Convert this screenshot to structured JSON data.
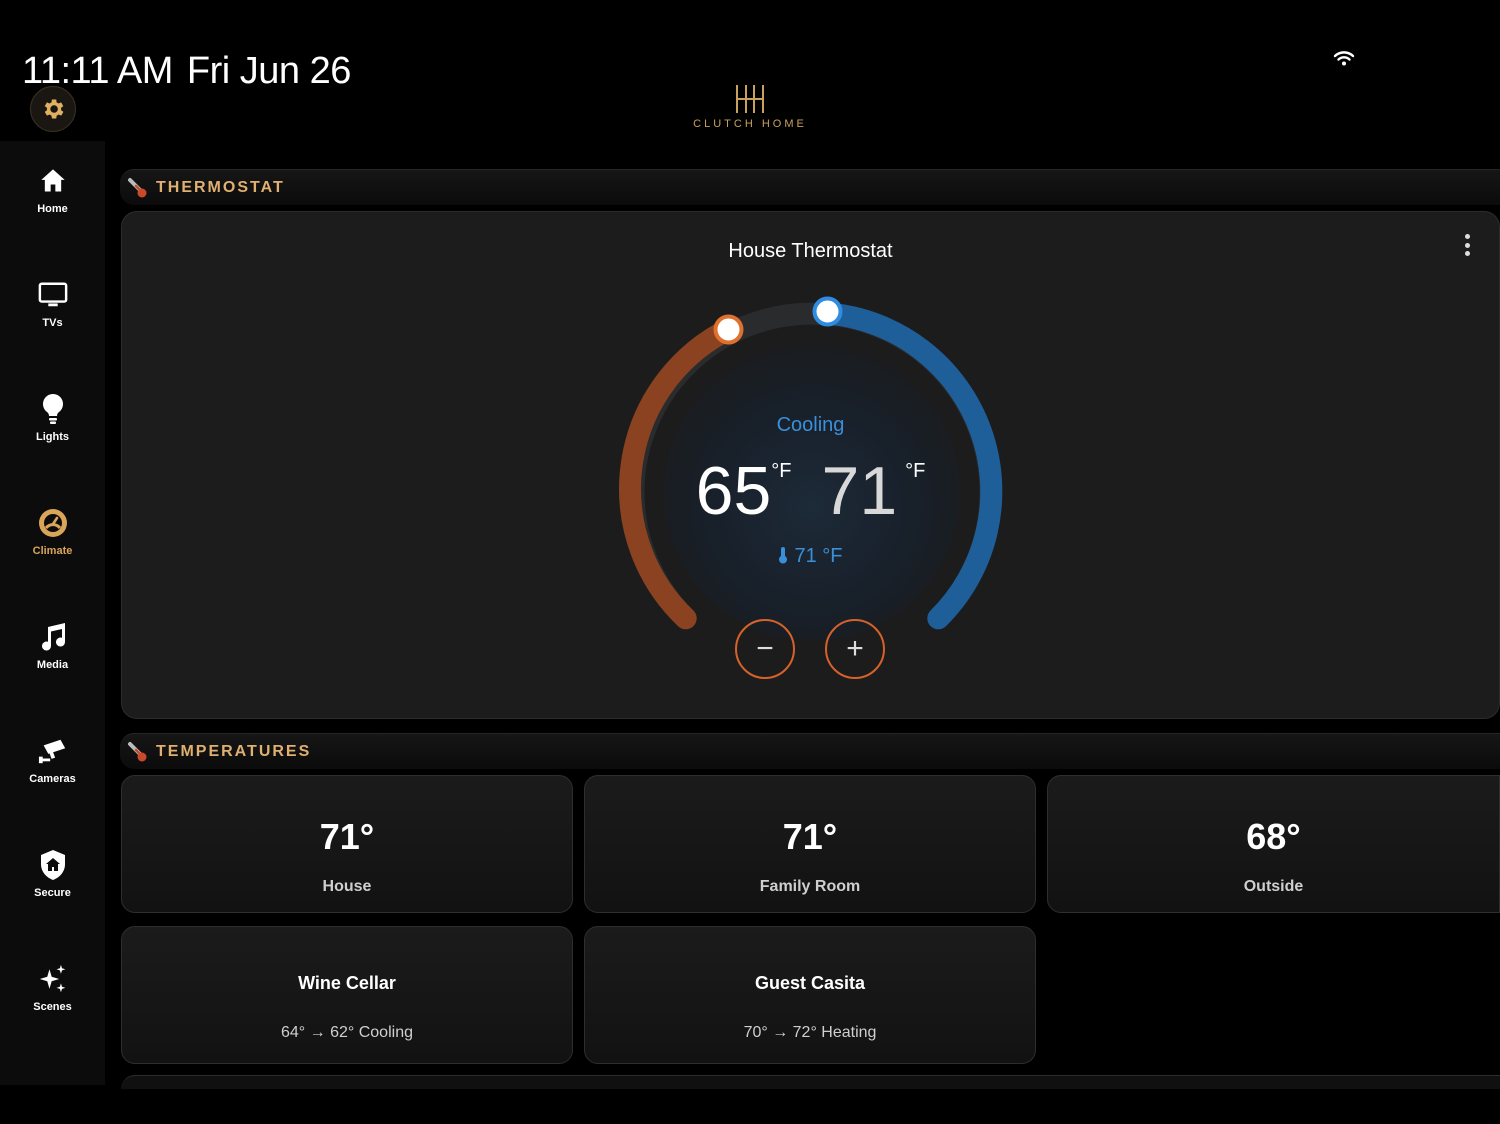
{
  "status": {
    "time": "11:11 AM",
    "date": "Fri Jun 26"
  },
  "brand": {
    "name": "CLUTCH HOME"
  },
  "sidebar": {
    "items": [
      {
        "label": "Home",
        "icon": "home-icon"
      },
      {
        "label": "TVs",
        "icon": "tv-icon"
      },
      {
        "label": "Lights",
        "icon": "lightbulb-icon"
      },
      {
        "label": "Climate",
        "icon": "climate-icon",
        "active": true
      },
      {
        "label": "Media",
        "icon": "music-note-icon"
      },
      {
        "label": "Cameras",
        "icon": "camera-icon"
      },
      {
        "label": "Secure",
        "icon": "shield-icon"
      },
      {
        "label": "Scenes",
        "icon": "sparkles-icon"
      }
    ]
  },
  "sections": {
    "thermostat": "THERMOSTAT",
    "temperatures": "TEMPERATURES"
  },
  "thermostat": {
    "title": "House Thermostat",
    "mode": "Cooling",
    "heat_setpoint": "65",
    "cool_setpoint": "71",
    "unit": "°F",
    "current": "71 °F",
    "decrease_label": "−",
    "increase_label": "+"
  },
  "temperatures": [
    {
      "value": "71°",
      "label": "House"
    },
    {
      "value": "71°",
      "label": "Family Room"
    },
    {
      "value": "68°",
      "label": "Outside"
    }
  ],
  "zones": [
    {
      "name": "Wine Cellar",
      "status": "64° → 62° Cooling"
    },
    {
      "name": "Guest Casita",
      "status": "70° → 72° Heating"
    }
  ],
  "colors": {
    "accent": "#d9a55a",
    "heat": "#d5622a",
    "cool": "#2f7fc4",
    "background": "#000000"
  }
}
